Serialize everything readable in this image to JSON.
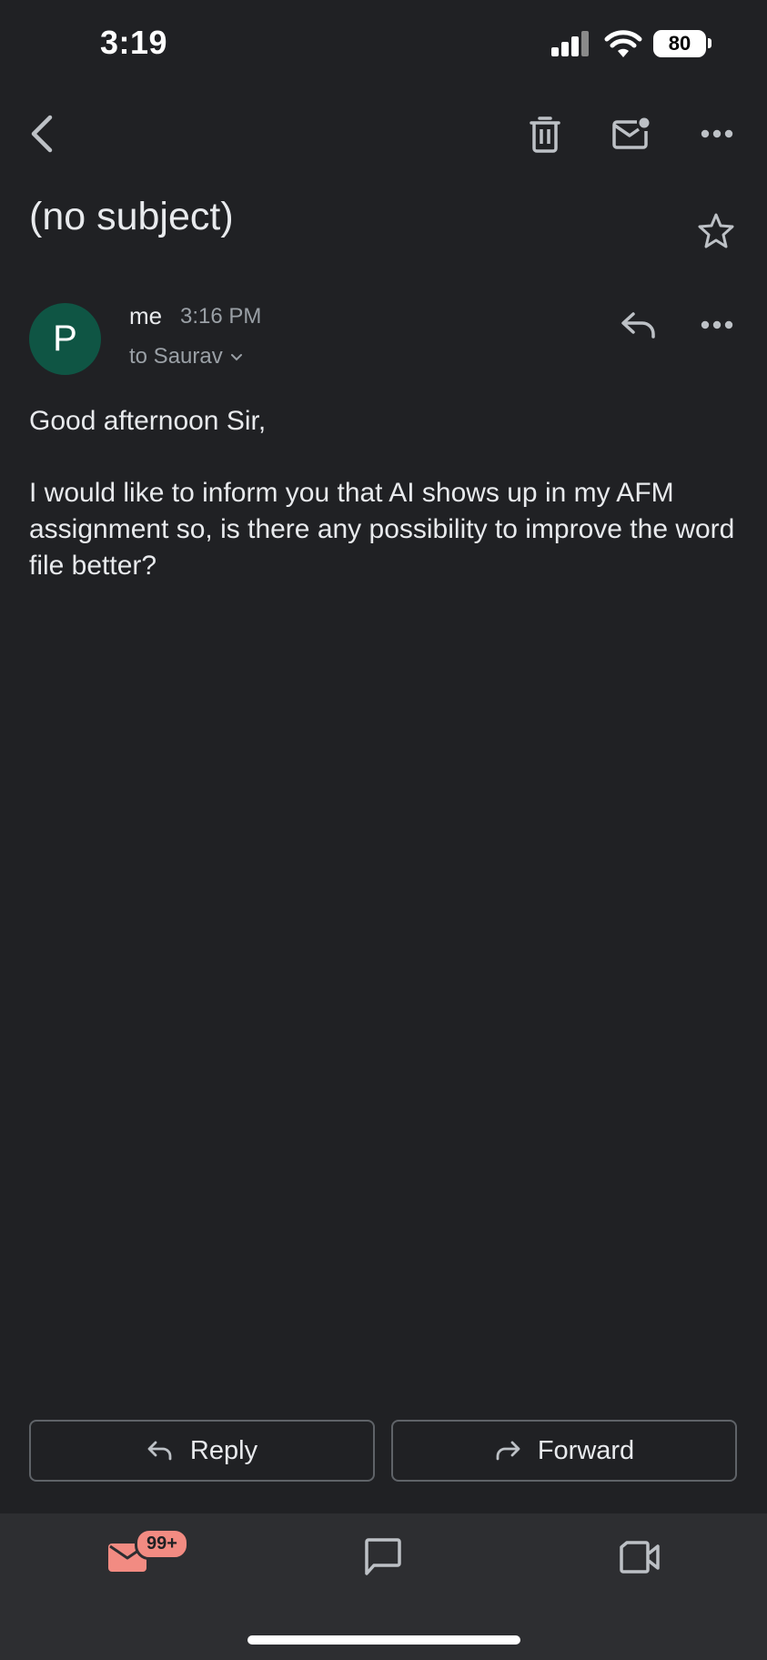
{
  "status_bar": {
    "time": "3:19",
    "battery": "80"
  },
  "toolbar": {
    "back_icon": "chevron-left-icon",
    "delete_icon": "trash-icon",
    "mark_unread_icon": "mail-unread-icon",
    "more_icon": "more-horizontal-icon"
  },
  "email": {
    "subject": "(no subject)",
    "sender": {
      "avatar_letter": "P",
      "name": "me",
      "time": "3:16 PM",
      "to": "to Saurav"
    },
    "body": {
      "greeting": "Good afternoon Sir,",
      "paragraph": "I would like to inform you that AI shows up in my AFM assignment so, is there any possibility to improve the word file better?"
    }
  },
  "actions": {
    "reply_label": "Reply",
    "forward_label": "Forward"
  },
  "tabbar": {
    "mail_badge": "99+"
  },
  "colors": {
    "background": "#202124",
    "avatar": "#0f5544",
    "mail_tab_accent": "#f28b82",
    "tabbar": "#2d2e31"
  }
}
